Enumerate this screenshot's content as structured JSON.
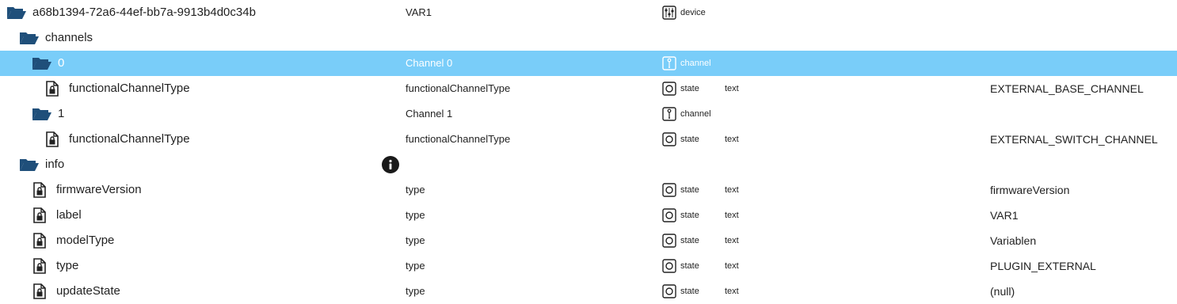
{
  "tree": {
    "rows": [
      {
        "key": "root",
        "label": "a68b1394-72a6-44ef-bb7a-9913b4d0c34b",
        "name": "VAR1",
        "role": "device",
        "type": "",
        "value": ""
      },
      {
        "key": "channels",
        "label": "channels",
        "name": "",
        "role": "",
        "type": "",
        "value": ""
      },
      {
        "key": "ch0",
        "label": "0",
        "name": "Channel 0",
        "role": "channel",
        "type": "",
        "value": ""
      },
      {
        "key": "ch0-fct",
        "label": "functionalChannelType",
        "name": "functionalChannelType",
        "role": "state",
        "type": "text",
        "value": "EXTERNAL_BASE_CHANNEL"
      },
      {
        "key": "ch1",
        "label": "1",
        "name": "Channel 1",
        "role": "channel",
        "type": "",
        "value": ""
      },
      {
        "key": "ch1-fct",
        "label": "functionalChannelType",
        "name": "functionalChannelType",
        "role": "state",
        "type": "text",
        "value": "EXTERNAL_SWITCH_CHANNEL"
      },
      {
        "key": "info",
        "label": "info",
        "name": "",
        "role": "",
        "type": "",
        "value": ""
      },
      {
        "key": "firmwareVersion",
        "label": "firmwareVersion",
        "name": "type",
        "role": "state",
        "type": "text",
        "value": "firmwareVersion"
      },
      {
        "key": "label",
        "label": "label",
        "name": "type",
        "role": "state",
        "type": "text",
        "value": "VAR1"
      },
      {
        "key": "modelType",
        "label": "modelType",
        "name": "type",
        "role": "state",
        "type": "text",
        "value": "Variablen"
      },
      {
        "key": "type",
        "label": "type",
        "name": "type",
        "role": "state",
        "type": "text",
        "value": "PLUGIN_EXTERNAL"
      },
      {
        "key": "updateState",
        "label": "updateState",
        "name": "type",
        "role": "state",
        "type": "text",
        "value": "(null)"
      }
    ]
  },
  "icons": {
    "folder": "folder-open-icon",
    "file": "locked-file-icon",
    "device": "device-icon",
    "channel": "channel-icon",
    "state": "state-icon",
    "info": "info-icon"
  },
  "colors": {
    "selected_row": "#79cdf9",
    "folder": "#1f4f7a"
  }
}
